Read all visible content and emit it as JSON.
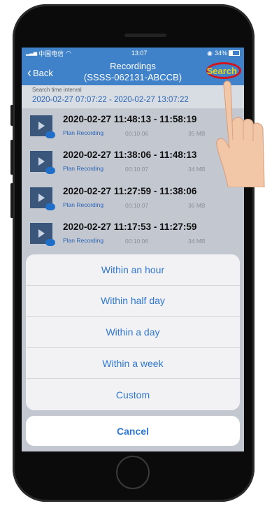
{
  "status_bar": {
    "carrier": "中国电信",
    "time": "13:07",
    "battery": "34%"
  },
  "nav": {
    "back_label": "Back",
    "title_line1": "Recordings",
    "title_line2": "(SSSS-062131-ABCCB)",
    "search_label": "Search"
  },
  "interval": {
    "label": "Search time interval",
    "value": "2020-02-27 07:07:22 - 2020-02-27 13:07:22"
  },
  "recordings": [
    {
      "time": "2020-02-27  11:48:13 - 11:58:19",
      "type": "Plan Recording",
      "duration": "00:10:06",
      "size": "35 MB"
    },
    {
      "time": "2020-02-27  11:38:06 - 11:48:13",
      "type": "Plan Recording",
      "duration": "00:10:07",
      "size": "34 MB"
    },
    {
      "time": "2020-02-27  11:27:59 - 11:38:06",
      "type": "Plan Recording",
      "duration": "00:10:07",
      "size": "36 MB"
    },
    {
      "time": "2020-02-27  11:17:53 - 11:27:59",
      "type": "Plan Recording",
      "duration": "00:10:06",
      "size": "34 MB"
    }
  ],
  "action_sheet": {
    "options": [
      "Within an hour",
      "Within half day",
      "Within a day",
      "Within a week",
      "Custom"
    ],
    "cancel_label": "Cancel"
  },
  "colors": {
    "nav_blue": "#3f82c9",
    "search_yellow": "#e8d21a",
    "highlight_red": "#d4141c",
    "option_blue": "#2f77d0"
  }
}
